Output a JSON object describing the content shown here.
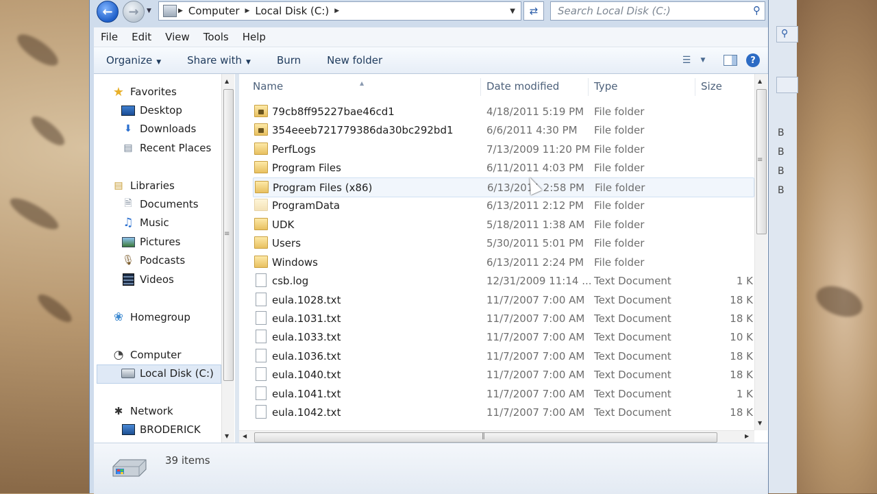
{
  "window": {
    "breadcrumb": [
      "Computer",
      "Local Disk (C:)"
    ],
    "search_placeholder": "Search Local Disk (C:)",
    "menu": [
      "File",
      "Edit",
      "View",
      "Tools",
      "Help"
    ],
    "commands": {
      "organize": "Organize",
      "share_with": "Share with",
      "burn": "Burn",
      "new_folder": "New folder"
    },
    "icons": {
      "back": "back-arrow-icon",
      "forward": "forward-arrow-icon",
      "refresh": "refresh-icon",
      "search": "search-icon",
      "views": "views-icon",
      "preview": "preview-pane-icon",
      "help": "help-icon"
    }
  },
  "nav": {
    "favorites": {
      "label": "Favorites",
      "items": [
        "Desktop",
        "Downloads",
        "Recent Places"
      ]
    },
    "libraries": {
      "label": "Libraries",
      "items": [
        "Documents",
        "Music",
        "Pictures",
        "Podcasts",
        "Videos"
      ]
    },
    "homegroup": "Homegroup",
    "computer": {
      "label": "Computer",
      "items": [
        "Local Disk (C:)"
      ]
    },
    "network": {
      "label": "Network",
      "items": [
        "BRODERICK"
      ]
    }
  },
  "columns": {
    "name": "Name",
    "date": "Date modified",
    "type": "Type",
    "size": "Size"
  },
  "files": [
    {
      "name": "79cb8ff95227bae46cd1",
      "date": "4/18/2011 5:19 PM",
      "type": "File folder",
      "size": "",
      "icon": "locked-folder"
    },
    {
      "name": "354eeeb721779386da30bc292bd1",
      "date": "6/6/2011 4:30 PM",
      "type": "File folder",
      "size": "",
      "icon": "locked-folder"
    },
    {
      "name": "PerfLogs",
      "date": "7/13/2009 11:20 PM",
      "type": "File folder",
      "size": "",
      "icon": "folder"
    },
    {
      "name": "Program Files",
      "date": "6/11/2011 4:03 PM",
      "type": "File folder",
      "size": "",
      "icon": "folder"
    },
    {
      "name": "Program Files (x86)",
      "date": "6/13/2011 2:58 PM",
      "type": "File folder",
      "size": "",
      "icon": "folder"
    },
    {
      "name": "ProgramData",
      "date": "6/13/2011 2:12 PM",
      "type": "File folder",
      "size": "",
      "icon": "hidden-folder"
    },
    {
      "name": "UDK",
      "date": "5/18/2011 1:38 AM",
      "type": "File folder",
      "size": "",
      "icon": "folder"
    },
    {
      "name": "Users",
      "date": "5/30/2011 5:01 PM",
      "type": "File folder",
      "size": "",
      "icon": "folder"
    },
    {
      "name": "Windows",
      "date": "6/13/2011 2:24 PM",
      "type": "File folder",
      "size": "",
      "icon": "folder"
    },
    {
      "name": "csb.log",
      "date": "12/31/2009 11:14 ...",
      "type": "Text Document",
      "size": "1 K",
      "icon": "document"
    },
    {
      "name": "eula.1028.txt",
      "date": "11/7/2007 7:00 AM",
      "type": "Text Document",
      "size": "18 K",
      "icon": "document"
    },
    {
      "name": "eula.1031.txt",
      "date": "11/7/2007 7:00 AM",
      "type": "Text Document",
      "size": "18 K",
      "icon": "document"
    },
    {
      "name": "eula.1033.txt",
      "date": "11/7/2007 7:00 AM",
      "type": "Text Document",
      "size": "10 K",
      "icon": "document"
    },
    {
      "name": "eula.1036.txt",
      "date": "11/7/2007 7:00 AM",
      "type": "Text Document",
      "size": "18 K",
      "icon": "document"
    },
    {
      "name": "eula.1040.txt",
      "date": "11/7/2007 7:00 AM",
      "type": "Text Document",
      "size": "18 K",
      "icon": "document"
    },
    {
      "name": "eula.1041.txt",
      "date": "11/7/2007 7:00 AM",
      "type": "Text Document",
      "size": "1 K",
      "icon": "document"
    },
    {
      "name": "eula.1042.txt",
      "date": "11/7/2007 7:00 AM",
      "type": "Text Document",
      "size": "18 K",
      "icon": "document"
    }
  ],
  "hover_file": "Program Files (x86)",
  "status": {
    "item_count": "39 items"
  },
  "background_window": {
    "letters": [
      "B",
      "B",
      "B",
      "B"
    ]
  }
}
